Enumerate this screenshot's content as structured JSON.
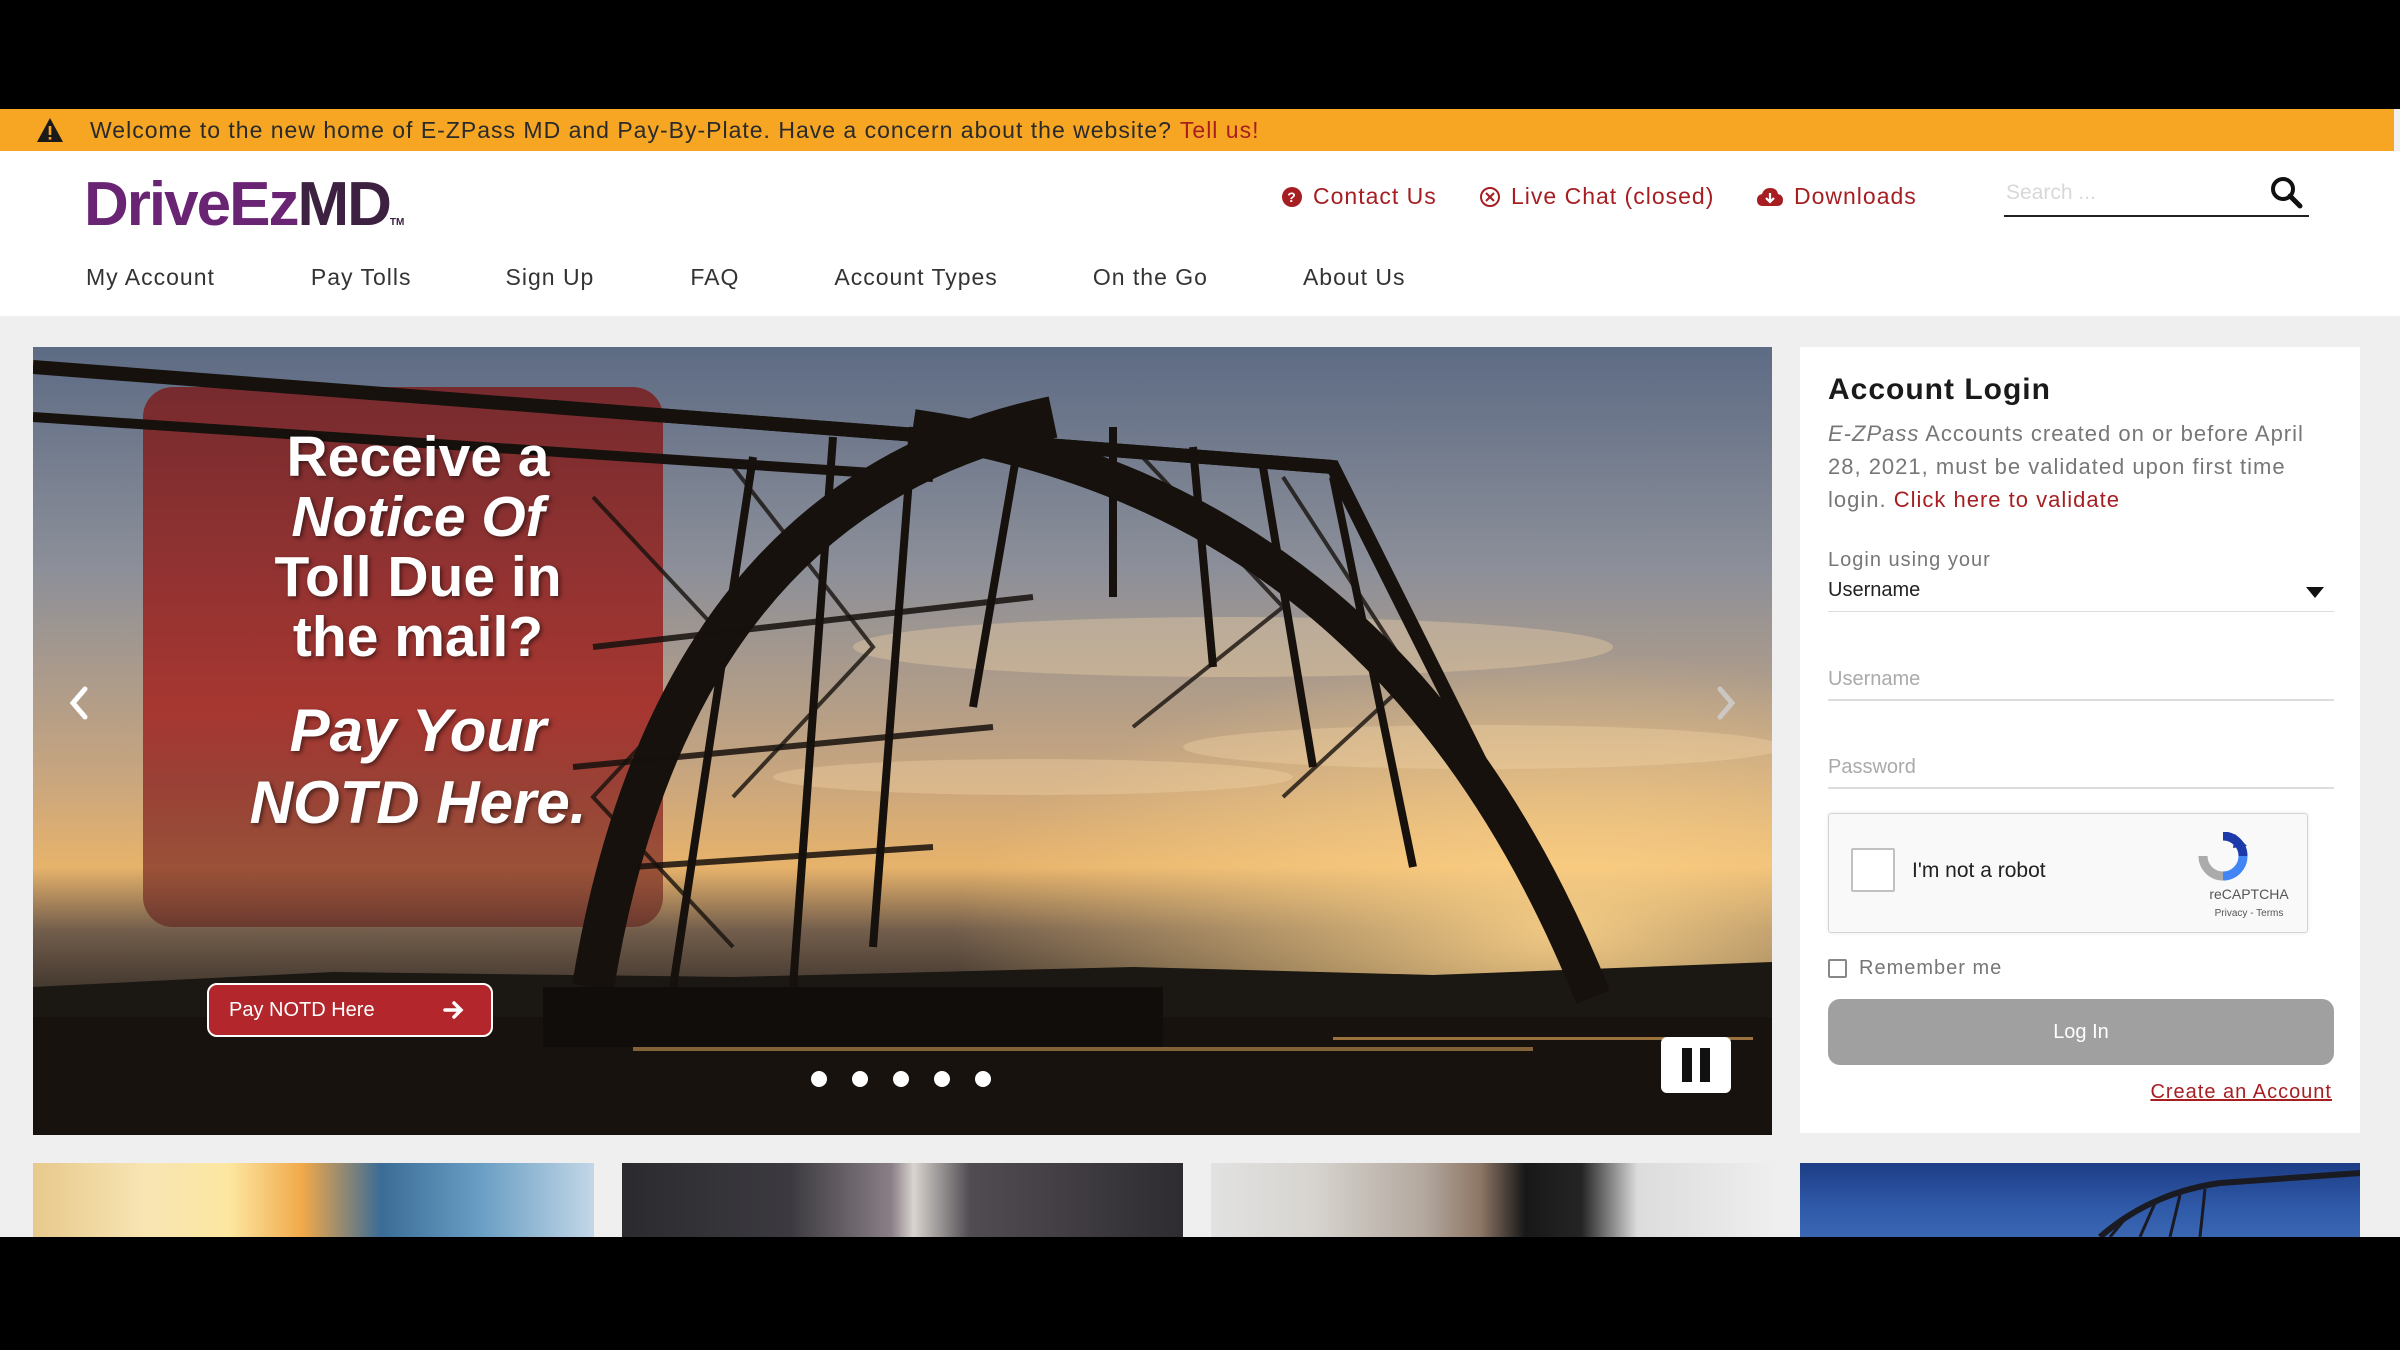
{
  "alert": {
    "message": "Welcome to the new home of E-ZPass MD and Pay-By-Plate. Have a concern about the website?",
    "link_label": "Tell us!"
  },
  "header": {
    "logo": {
      "part1": "DriveEz",
      "part2": "MD",
      "tm": "TM"
    },
    "utility_links": [
      {
        "label": "Contact Us",
        "icon": "question-circle-icon"
      },
      {
        "label": "Live Chat (closed)",
        "icon": "x-circle-icon"
      },
      {
        "label": "Downloads",
        "icon": "cloud-download-icon"
      }
    ],
    "search": {
      "placeholder": "Search ...",
      "icon": "search-icon"
    },
    "nav": [
      "My Account",
      "Pay Tolls",
      "Sign Up",
      "FAQ",
      "Account Types",
      "On the Go",
      "About Us"
    ]
  },
  "hero": {
    "line1": "Receive a",
    "line2": "Notice Of",
    "line3": "Toll Due in",
    "line4": "the mail?",
    "line5a": "Pay Your",
    "line5b": "NOTD Here.",
    "button_label": "Pay NOTD Here",
    "slide_count": 5
  },
  "login": {
    "title": "Account Login",
    "message_em": "E-ZPass",
    "message": " Accounts created on or before April 28, 2021, must be validated upon first time login.",
    "validate_link": "Click here to validate",
    "login_using_label": "Login using your",
    "login_type": "Username",
    "username_placeholder": "Username",
    "password_placeholder": "Password",
    "recaptcha_label": "I'm not a robot",
    "recaptcha_brand": "reCAPTCHA",
    "recaptcha_terms": "Privacy - Terms",
    "remember_label": "Remember me",
    "login_button": "Log In",
    "create_account": "Create an Account"
  },
  "colors": {
    "accent": "#a61e22",
    "alert_bg": "#f6a623",
    "logo_purple": "#6a2474",
    "logo_dark": "#3c2140"
  }
}
